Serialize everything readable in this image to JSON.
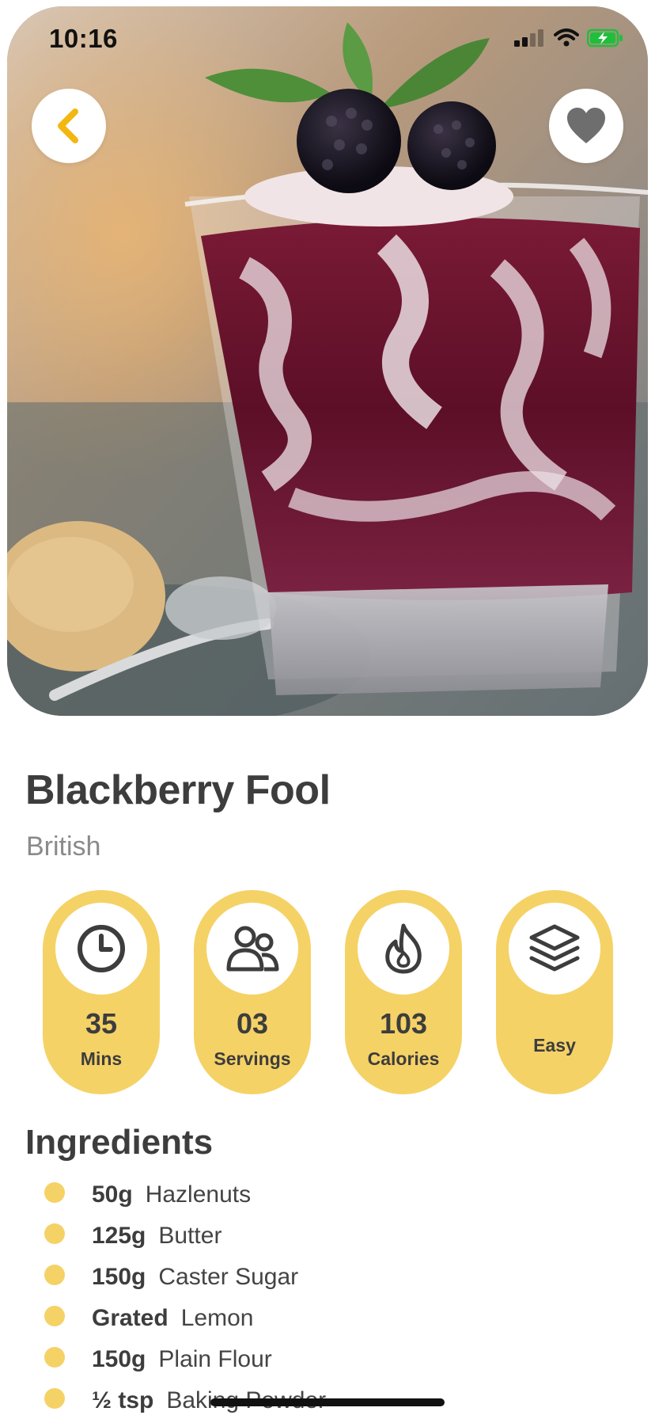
{
  "status_bar": {
    "time": "10:16"
  },
  "hero": {
    "image_subject": "blackberry-fool-dessert-photo"
  },
  "recipe": {
    "title": "Blackberry Fool",
    "cuisine": "British"
  },
  "stats": [
    {
      "icon": "clock-icon",
      "value": "35",
      "label": "Mins"
    },
    {
      "icon": "people-icon",
      "value": "03",
      "label": "Servings"
    },
    {
      "icon": "flame-icon",
      "value": "103",
      "label": "Calories"
    },
    {
      "icon": "layers-icon",
      "value": "",
      "label": "Easy"
    }
  ],
  "ingredients_section": {
    "title": "Ingredients",
    "items": [
      {
        "qty": "50g",
        "name": "Hazlenuts"
      },
      {
        "qty": "125g",
        "name": "Butter"
      },
      {
        "qty": "150g",
        "name": "Caster Sugar"
      },
      {
        "qty": "Grated",
        "name": "Lemon"
      },
      {
        "qty": "150g",
        "name": "Plain Flour"
      },
      {
        "qty": "½ tsp",
        "name": "Baking Powder"
      }
    ]
  },
  "colors": {
    "accent": "#f5d266",
    "back_arrow": "#f2b711",
    "text_dark": "#3d3d3d",
    "text_muted": "#8a8a8a",
    "heart": "#6e6e6e"
  }
}
